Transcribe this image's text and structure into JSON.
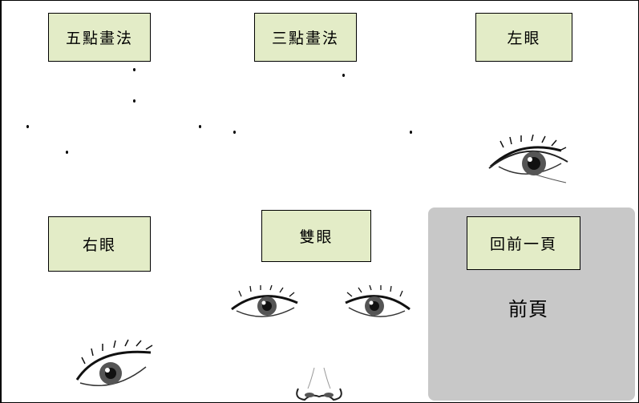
{
  "buttons": {
    "five_point": "五點畫法",
    "three_point": "三點畫法",
    "left_eye": "左眼",
    "right_eye": "右眼",
    "both_eyes": "雙眼",
    "back": "回前一頁"
  },
  "panel": {
    "label": "前頁"
  },
  "colors": {
    "button_bg": "#e3ecc7",
    "panel_bg": "#c8c8c8"
  },
  "icons": [
    "left-eye-image",
    "right-eye-image",
    "both-eyes-image",
    "nose-image"
  ]
}
